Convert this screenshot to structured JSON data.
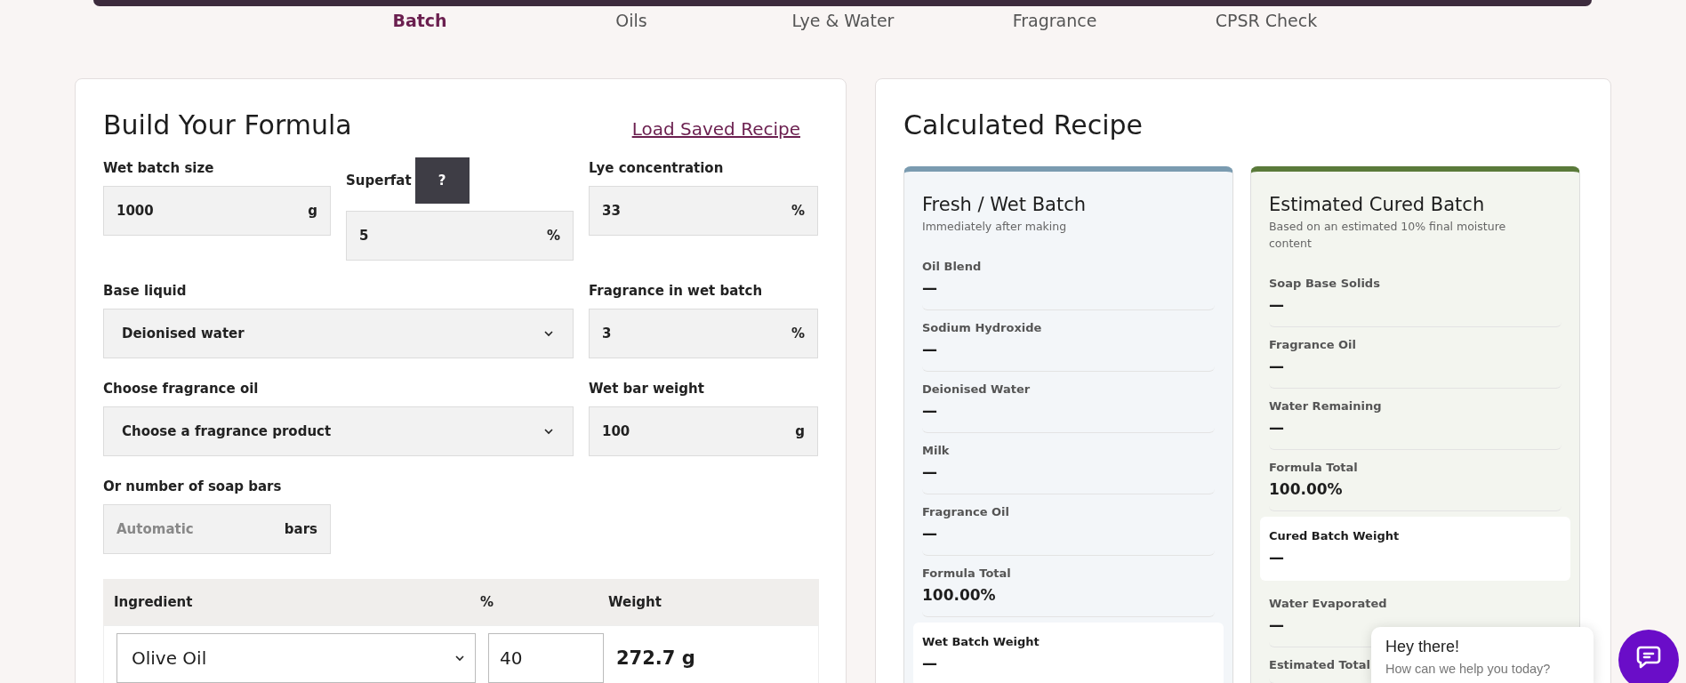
{
  "nav": {
    "tabs": [
      {
        "label": "Batch",
        "selected": true
      },
      {
        "label": "Oils",
        "selected": false
      },
      {
        "label": "Lye & Water",
        "selected": false
      },
      {
        "label": "Fragrance",
        "selected": false
      },
      {
        "label": "CPSR Check",
        "selected": false
      }
    ]
  },
  "formula": {
    "title": "Build Your Formula",
    "link": "Load Saved Recipe",
    "fields": [
      {
        "kind": "input",
        "label": "Wet batch size",
        "value": "1000",
        "unit": "g"
      },
      {
        "kind": "input",
        "label": "Superfat",
        "help": "?",
        "value": "5",
        "unit": "%"
      },
      {
        "kind": "input",
        "label": "Lye concentration",
        "value": "33",
        "unit": "%"
      },
      {
        "kind": "select",
        "label": "Base liquid",
        "value": "Deionised water"
      },
      {
        "kind": "input",
        "label": "Fragrance in wet batch",
        "value": "3",
        "unit": "%"
      },
      {
        "kind": "select",
        "label": "Choose fragrance oil",
        "value": "Choose a fragrance product"
      },
      {
        "kind": "input",
        "label": "Wet bar weight",
        "value": "100",
        "unit": "g"
      },
      {
        "kind": "input",
        "label": "Or number of soap bars",
        "placeholder": "Automatic",
        "unit": "bars"
      }
    ],
    "table": {
      "columns": [
        "Ingredient",
        "%",
        "Weight"
      ],
      "rows": [
        {
          "ingredient": "Olive Oil",
          "percent": "40",
          "weight": "272.7 g"
        }
      ]
    }
  },
  "recipe": {
    "title": "Calculated Recipe",
    "panels": [
      {
        "kind": "fresh",
        "title": "Fresh / Wet Batch",
        "subtitle": "Immediately after making",
        "items": [
          {
            "label": "Oil Blend",
            "value": "—",
            "highlighted": false
          },
          {
            "label": "Sodium Hydroxide",
            "value": "—",
            "highlighted": false
          },
          {
            "label": "Deionised Water",
            "value": "—",
            "highlighted": false
          },
          {
            "label": "Milk",
            "value": "—",
            "highlighted": false
          },
          {
            "label": "Fragrance Oil",
            "value": "—",
            "highlighted": false
          },
          {
            "label": "Formula Total",
            "value": "100.00%",
            "highlighted": false
          },
          {
            "label": "Wet Batch Weight",
            "value": "—",
            "highlighted": true
          }
        ]
      },
      {
        "kind": "cured",
        "title": "Estimated Cured Batch",
        "subtitle": "Based on an estimated 10% final moisture content",
        "items": [
          {
            "label": "Soap Base Solids",
            "value": "—",
            "highlighted": false
          },
          {
            "label": "Fragrance Oil",
            "value": "—",
            "highlighted": false
          },
          {
            "label": "Water Remaining",
            "value": "—",
            "highlighted": false
          },
          {
            "label": "Formula Total",
            "value": "100.00%",
            "highlighted": false
          },
          {
            "label": "Cured Batch Weight",
            "value": "—",
            "highlighted": true
          },
          {
            "label": "Water Evaporated",
            "value": "—",
            "highlighted": false
          },
          {
            "label": "Estimated Total",
            "highlighted": false
          }
        ]
      }
    ]
  },
  "chat": {
    "greeting": "Hey there!",
    "prompt": "How can we help you today?"
  }
}
